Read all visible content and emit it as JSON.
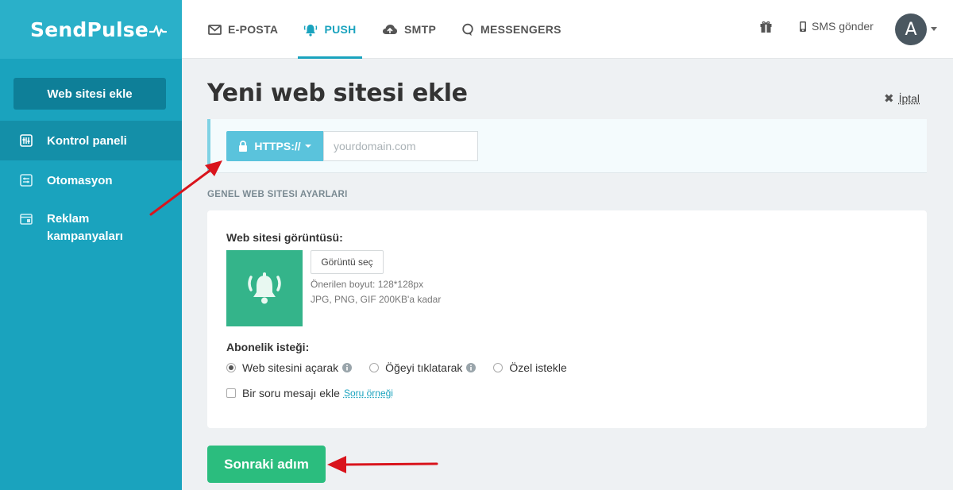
{
  "brand": {
    "name": "SendPulse"
  },
  "sidebar": {
    "add_site_label": "Web sitesi ekle",
    "items": [
      {
        "label": "Kontrol paneli",
        "icon": "sliders-icon",
        "active": true
      },
      {
        "label": "Otomasyon",
        "icon": "automation-icon",
        "active": false
      },
      {
        "label_line1": "Reklam",
        "label_line2": "kampanyaları",
        "icon": "browser-window-icon",
        "active": false
      }
    ]
  },
  "topnav": {
    "tabs": [
      {
        "label": "E-POSTA",
        "icon": "envelope-icon"
      },
      {
        "label": "PUSH",
        "icon": "bell-icon",
        "active": true
      },
      {
        "label": "SMTP",
        "icon": "cloud-upload-icon"
      },
      {
        "label": "MESSENGERS",
        "icon": "chat-bubble-icon"
      }
    ],
    "sms_label": "SMS gönder",
    "avatar_letter": "A"
  },
  "page": {
    "title": "Yeni web sitesi ekle",
    "cancel_label": "İptal"
  },
  "domain": {
    "protocol": "HTTPS://",
    "placeholder": "yourdomain.com",
    "value": ""
  },
  "settings": {
    "section_label": "GENEL WEB SITESI AYARLARI",
    "image_label": "Web sitesi görüntüsü:",
    "choose_image_label": "Görüntü seç",
    "hint_size": "Önerilen boyut: 128*128px",
    "hint_formats": "JPG, PNG, GIF 200KB'a kadar",
    "subscription_label": "Abonelik isteği:",
    "options": [
      {
        "label": "Web sitesini açarak",
        "selected": true,
        "info": true
      },
      {
        "label": "Öğeyi tıklatarak",
        "selected": false,
        "info": true
      },
      {
        "label": "Özel istekle",
        "selected": false,
        "info": false
      }
    ],
    "question_checkbox_label": "Bir soru mesajı ekle",
    "question_sample_link": "Soru örneği"
  },
  "next_button_label": "Sonraki adım",
  "colors": {
    "sidebar": "#1aa3be",
    "accent": "#1aa3be",
    "next_button": "#2bbd7e",
    "thumb": "#34b48a",
    "annotation_arrow": "#d9141c"
  }
}
